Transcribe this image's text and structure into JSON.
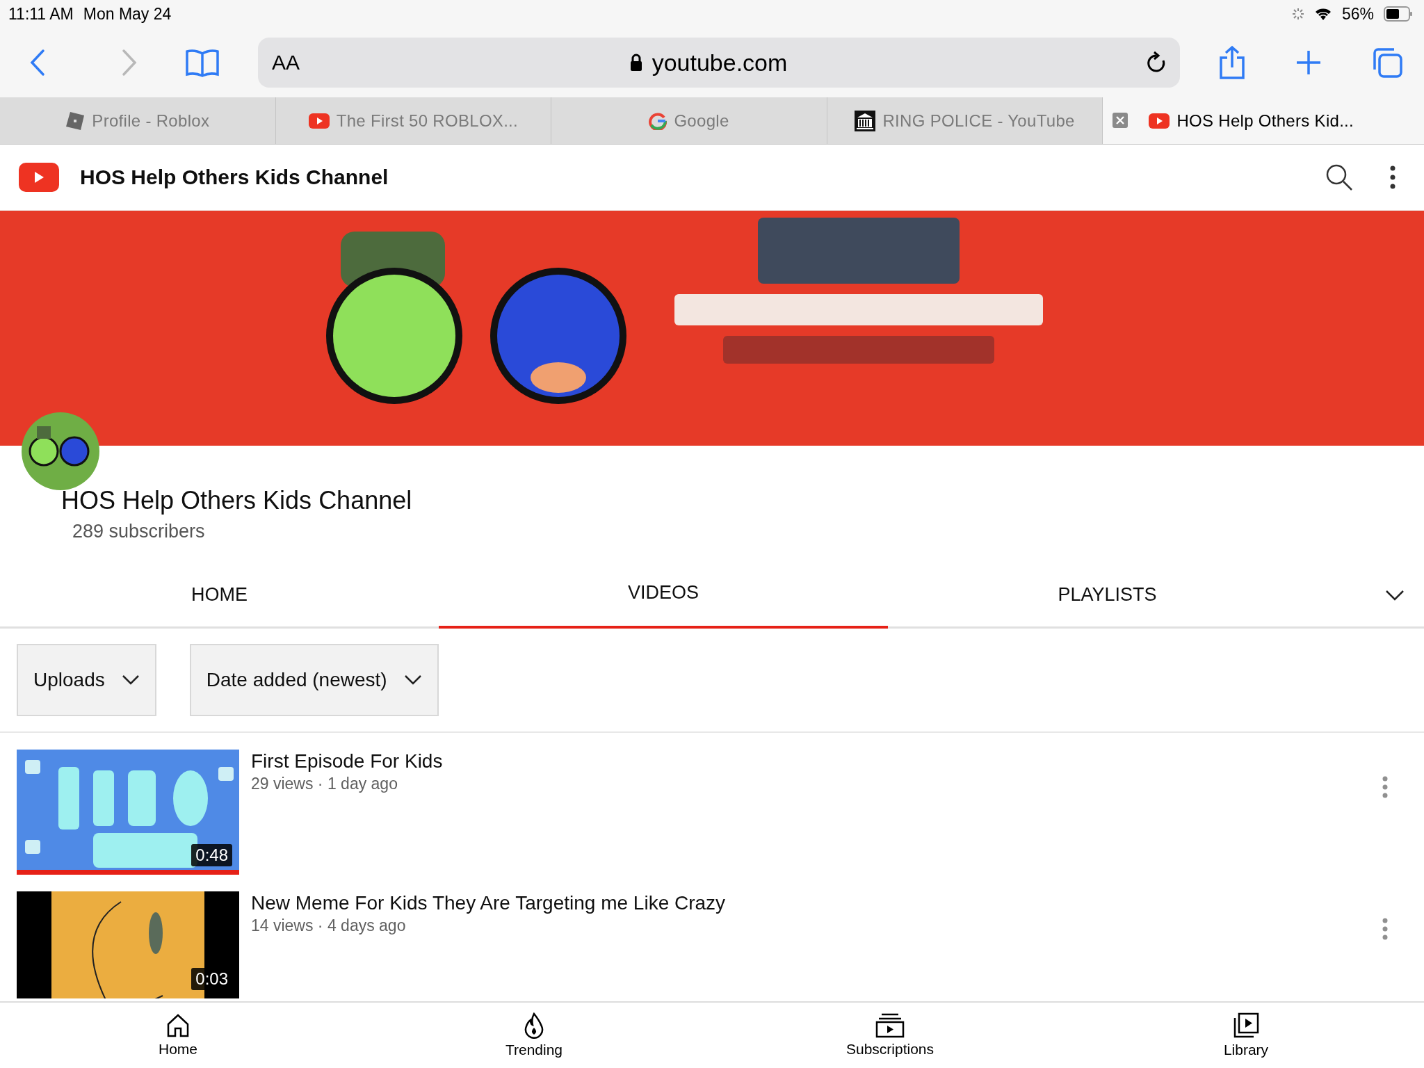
{
  "status_bar": {
    "time": "11:11 AM",
    "date": "Mon May 24",
    "battery": "56%"
  },
  "toolbar": {
    "text_size": "AA",
    "url": "youtube.com"
  },
  "browser_tabs": [
    {
      "title": "Profile - Roblox",
      "kind": "square",
      "selected": false
    },
    {
      "title": "The First 50 ROBLOX...",
      "kind": "play",
      "selected": false
    },
    {
      "title": "Google",
      "kind": "letter",
      "selected": false
    },
    {
      "title": "RING POLICE - YouTube",
      "kind": "building",
      "selected": false
    },
    {
      "title": "HOS Help Others Kid...",
      "kind": "play",
      "selected": true
    }
  ],
  "header": {
    "title": "HOS Help Others Kids Channel"
  },
  "banner": {
    "kind": "picture"
  },
  "channel": {
    "name": "HOS Help Others Kids Channel",
    "subscribers": "289 subscribers"
  },
  "channel_tabs": [
    {
      "label": "HOME",
      "selected": false
    },
    {
      "label": "VIDEOS",
      "selected": true
    },
    {
      "label": "PLAYLISTS",
      "selected": false
    }
  ],
  "filters": [
    "Uploads",
    "Date added (newest)"
  ],
  "videos": [
    {
      "title": "First Episode For Kids",
      "meta": "29 views · 1 day ago",
      "duration": "0:48",
      "kind": "picture",
      "level": 1
    },
    {
      "title": "New Meme For Kids They Are Targeting me Like Crazy",
      "meta": "14 views · 4 days ago",
      "duration": "0:03",
      "kind": "picture"
    }
  ],
  "bottom_nav": [
    {
      "label": "Home",
      "kind": "home"
    },
    {
      "label": "Trending",
      "kind": "flame"
    },
    {
      "label": "Subscriptions",
      "kind": "subs"
    },
    {
      "label": "Library",
      "kind": "library"
    }
  ]
}
